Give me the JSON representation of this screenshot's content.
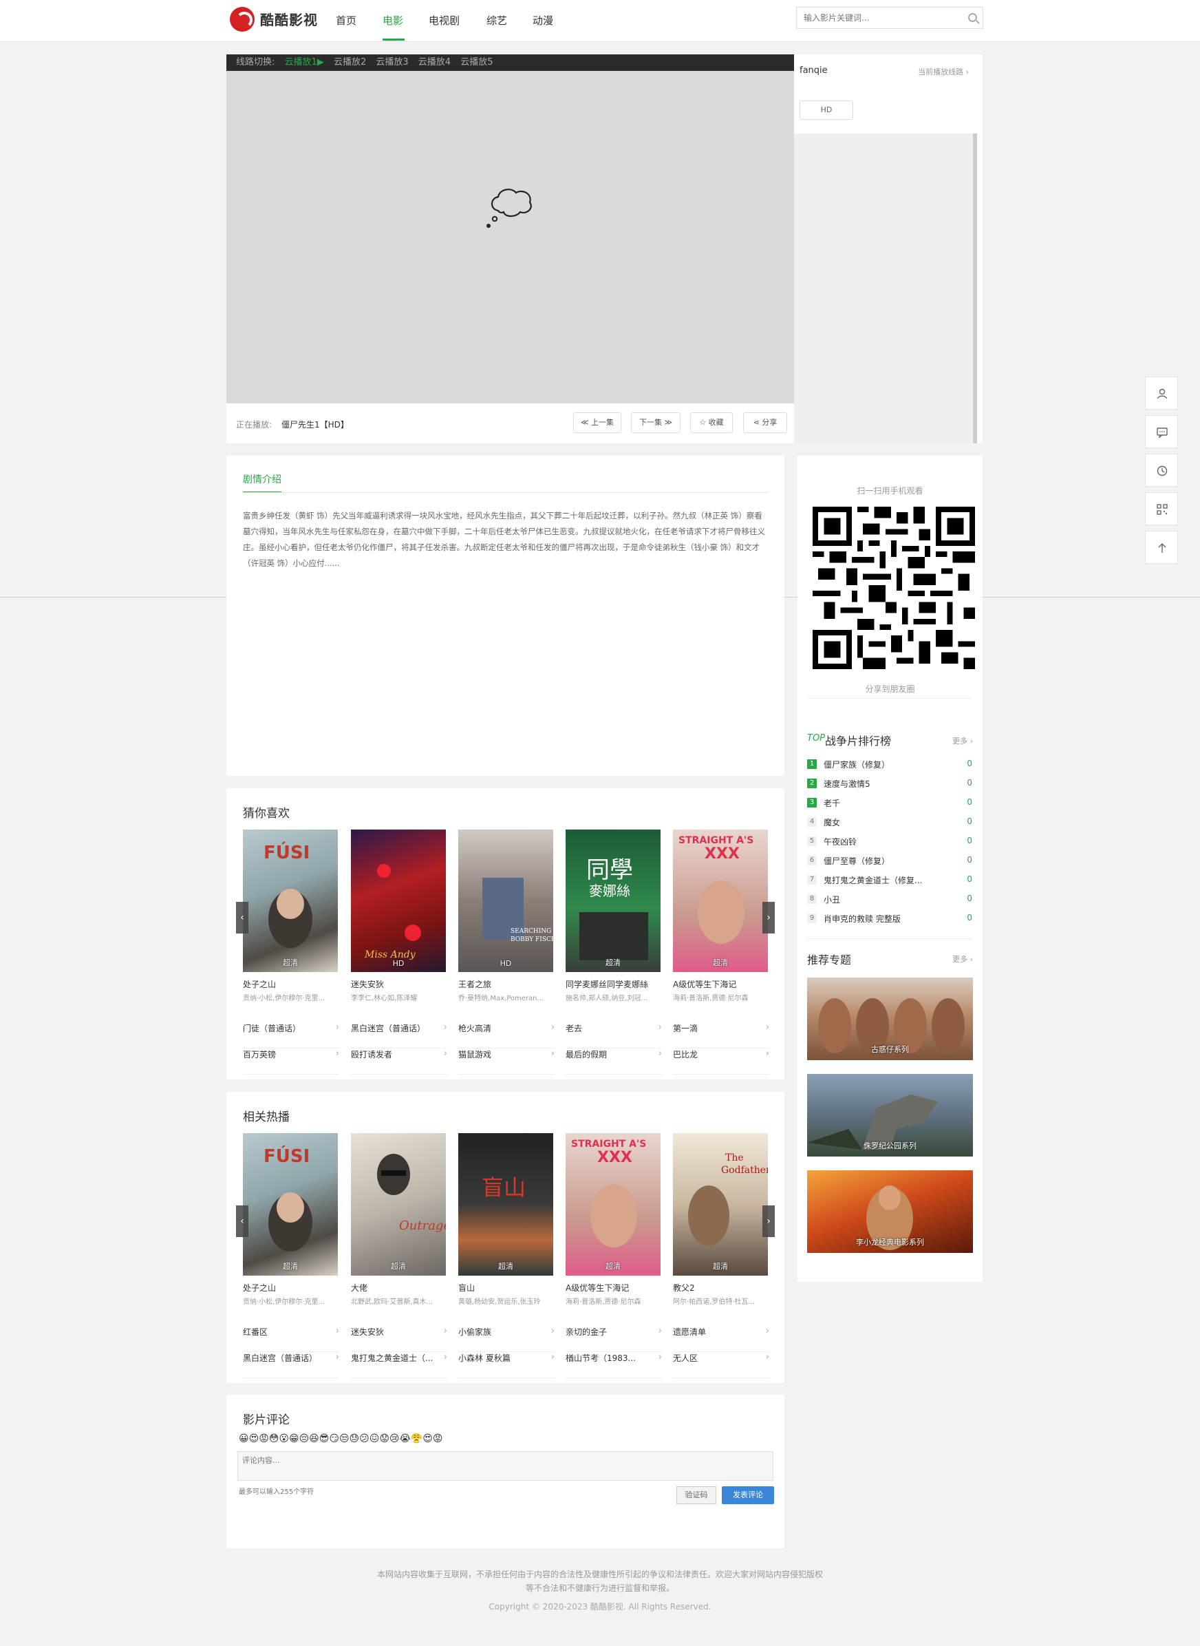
{
  "header": {
    "logo_text": "酷酷影视",
    "nav": [
      "首页",
      "电影",
      "电视剧",
      "综艺",
      "动漫"
    ],
    "active_index": 1,
    "search_placeholder": "输入影片关键词..."
  },
  "player": {
    "line_label": "线路切换:",
    "lines": [
      "云播放1▶",
      "云播放2",
      "云播放3",
      "云播放4",
      "云播放5"
    ],
    "now_playing_label": "正在播放:",
    "now_playing_title": "僵尸先生1【HD】",
    "buttons": {
      "prev": "≪ 上一集",
      "next": "下一集 ≫",
      "fav": "☆ 收藏",
      "share": "分享"
    },
    "source_name": "fanqie",
    "current_source_label": "当前播放线路",
    "episode": "HD"
  },
  "intro": {
    "tab": "剧情介绍",
    "text": "富贵乡绅任发（黄虾 饰）先父当年威逼利诱求得一块风水宝地，经风水先生指点，其父下葬二十年后起坟迁葬，以利子孙。然九叔（林正英 饰）察看墓穴得知，当年风水先生与任家私怨在身，在墓穴中做下手脚，二十年后任老太爷尸体已生恶变。九叔提议就地火化，在任老爷请求下才将尸骨移往义庄。虽经小心看护，但任老太爷仍化作僵尸，将其子任发杀害。九叔断定任老太爷和任发的僵尸将再次出现，于是命令徒弟秋生（钱小豪 饰）和文才（许冠英 饰）小心应付......"
  },
  "guess": {
    "title": "猜你喜欢",
    "posters": [
      {
        "title": "处子之山",
        "cast": "贡纳·小松,伊尔穆尔·克里...",
        "badge": "超清"
      },
      {
        "title": "迷失安狄",
        "cast": "李李仁,林心如,陈泽耀",
        "badge": "HD"
      },
      {
        "title": "王者之旅",
        "cast": "乔·曼特纳,Max,Pomeran...",
        "badge": "HD"
      },
      {
        "title": "同学麦娜丝同学麦娜絲",
        "cast": "施名帅,郑人硕,纳豆,刘冠...",
        "badge": "超清"
      },
      {
        "title": "A级优等生下海记",
        "cast": "海莉·普洛斯,贾德·尼尔森",
        "badge": "超清"
      }
    ],
    "links": [
      [
        "门徒（普通话）",
        "黑白迷宫（普通话）",
        "枪火高清",
        "老去",
        "第一滴"
      ],
      [
        "百万英镑",
        "殴打诱发者",
        "猫鼠游戏",
        "最后的假期",
        "巴比龙"
      ]
    ]
  },
  "hot": {
    "title": "相关热播",
    "posters": [
      {
        "title": "处子之山",
        "cast": "贡纳·小松,伊尔穆尔·克里...",
        "badge": "超清"
      },
      {
        "title": "大佬",
        "cast": "北野武,欧玛·艾普斯,真木...",
        "badge": "超清"
      },
      {
        "title": "盲山",
        "cast": "黄璐,杨幼安,贺运乐,张玉玲",
        "badge": "超清"
      },
      {
        "title": "A级优等生下海记",
        "cast": "海莉·普洛斯,贾德·尼尔森",
        "badge": "超清"
      },
      {
        "title": "教父2",
        "cast": "阿尔·帕西诺,罗伯特·杜瓦...",
        "badge": "超清"
      }
    ],
    "links": [
      [
        "红番区",
        "迷失安狄",
        "小偷家族",
        "亲切的金子",
        "遗愿清单"
      ],
      [
        "黑白迷宫（普通话）",
        "鬼打鬼之黄金道士（...",
        "小森林 夏秋篇",
        "楢山节考（1983...",
        "无人区"
      ]
    ]
  },
  "qr": {
    "scan_label": "扫一扫用手机观看",
    "share_label": "分享到朋友圈"
  },
  "rank": {
    "top": "TOP",
    "title": "战争片排行榜",
    "more": "更多",
    "items": [
      {
        "n": "1",
        "name": "僵尸家族（修复）",
        "score": "0"
      },
      {
        "n": "2",
        "name": "速度与激情5",
        "score": "0"
      },
      {
        "n": "3",
        "name": "老千",
        "score": "0"
      },
      {
        "n": "4",
        "name": "魔女",
        "score": "0"
      },
      {
        "n": "5",
        "name": "午夜凶铃",
        "score": "0"
      },
      {
        "n": "6",
        "name": "僵尸至尊（修复）",
        "score": "0"
      },
      {
        "n": "7",
        "name": "鬼打鬼之黄金道士（修复...",
        "score": "0"
      },
      {
        "n": "8",
        "name": "小丑",
        "score": "0"
      },
      {
        "n": "9",
        "name": "肖申克的救赎 完整版",
        "score": "0"
      }
    ]
  },
  "topics": {
    "title": "推荐专题",
    "more": "更多",
    "items": [
      "古惑仔系列",
      "侏罗纪公园系列",
      "李小龙经典电影系列"
    ]
  },
  "comments": {
    "title": "影片评论",
    "emojis": "😀😍😡😳😮😁😔😆😎😏😒😓😕😖😟😢😭😤😍😡",
    "placeholder": "评论内容...",
    "limit": "最多可以输入255个字符",
    "captcha": "验证码",
    "submit": "发表评论"
  },
  "footer": {
    "line1": "本网站内容收集于互联网，不承担任何由于内容的合法性及健康性所引起的争议和法律责任。欢迎大家对网站内容侵犯版权",
    "line2": "等不合法和不健康行为进行监督和举报。",
    "line3": "Copyright © 2020-2023 酷酷影视. All Rights Reserved."
  },
  "colors": {
    "accent": "#28a745",
    "dark_bar": "#2b2b2b",
    "video_bg": "#dadada",
    "submit": "#3a87d9"
  }
}
